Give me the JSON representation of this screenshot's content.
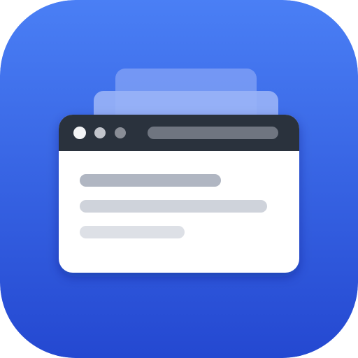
{
  "app_icon": {
    "icon_name": "browser-window-tabs-icon",
    "colors": {
      "background_top": "#4a7ff5",
      "background_bottom": "#2448d1",
      "back_tab_far": "#7d9ef5",
      "back_tab_near": "#99b3f7",
      "window_body": "#ffffff",
      "title_bar": "#2b313d",
      "dot_1": "#f3f4f6",
      "dot_2": "#c2c5cc",
      "dot_3": "#898d96",
      "address_bar": "#6f7580",
      "text_line_1": "#b0b6c2",
      "text_line_2": "#cfd3db",
      "text_line_3": "#dde0e6"
    }
  }
}
